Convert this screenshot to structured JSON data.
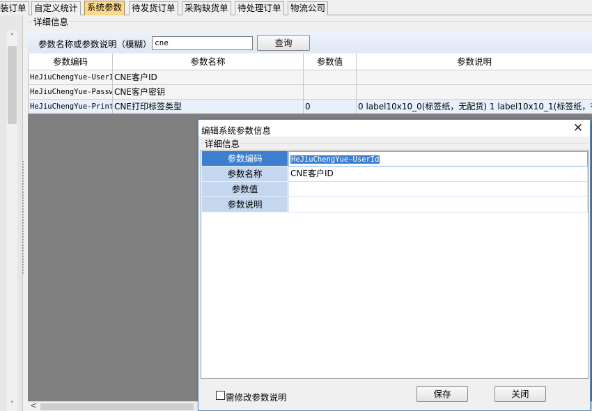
{
  "tabs": [
    {
      "label": "装订单",
      "active": false
    },
    {
      "label": "自定义统计",
      "active": false
    },
    {
      "label": "系统参数",
      "active": true
    },
    {
      "label": "待发货订单",
      "active": false
    },
    {
      "label": "采购缺货单",
      "active": false
    },
    {
      "label": "待处理订单",
      "active": false
    },
    {
      "label": "物流公司",
      "active": false
    }
  ],
  "group_title": "详细信息",
  "search": {
    "label": "参数名称或参数说明（模糊）",
    "value": "cne",
    "button": "查询"
  },
  "grid": {
    "columns": [
      "参数编码",
      "参数名称",
      "参数值",
      "参数说明"
    ],
    "rows": [
      {
        "code": "HeJiuChengYue-UserI",
        "name": "CNE客户ID",
        "value": "",
        "desc": ""
      },
      {
        "code": "HeJiuChengYue-Passw",
        "name": "CNE客户密钥",
        "value": "",
        "desc": ""
      },
      {
        "code": "HeJiuChengYue-Print",
        "name": "CNE打印标签类型",
        "value": "0",
        "desc": "0 label10x10_0(标签纸，无配货) 1 label10x10_1(标签纸，有"
      }
    ]
  },
  "dialog": {
    "title": "编辑系统参数信息",
    "close_icon": "close-icon",
    "group_title": "详细信息",
    "fields": [
      {
        "label": "参数编码",
        "value": "HeJiuChengYue-UserId",
        "selected": true
      },
      {
        "label": "参数名称",
        "value": "CNE客户ID",
        "selected": false
      },
      {
        "label": "参数值",
        "value": "",
        "selected": false
      },
      {
        "label": "参数说明",
        "value": "",
        "selected": false
      }
    ],
    "checkbox_label": "需修改参数说明",
    "checkbox_checked": false,
    "save_label": "保存",
    "close_label": "关闭"
  },
  "colors": {
    "active_tab": "#ffd98a",
    "selection": "#3d7fcf",
    "label_cell": "#c4d7ee"
  }
}
